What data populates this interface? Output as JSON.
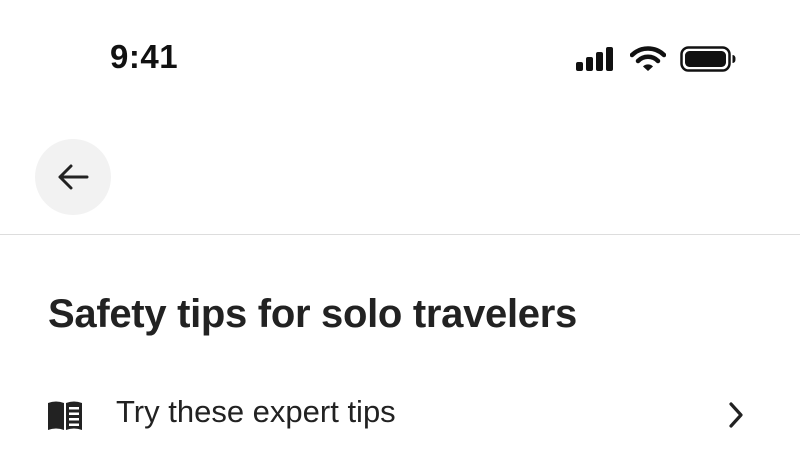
{
  "status_bar": {
    "time": "9:41",
    "icons": [
      "cellular-signal-icon",
      "wifi-icon",
      "battery-icon"
    ]
  },
  "nav": {
    "back_icon": "arrow-left-icon"
  },
  "main": {
    "title": "Safety tips for solo travelers",
    "rows": [
      {
        "icon": "book-icon",
        "label": "Try these expert tips",
        "trailing_icon": "chevron-right-icon"
      }
    ]
  },
  "colors": {
    "text": "#222222",
    "divider": "#dddddd",
    "back_button_bg": "#f2f2f2",
    "background": "#ffffff"
  }
}
